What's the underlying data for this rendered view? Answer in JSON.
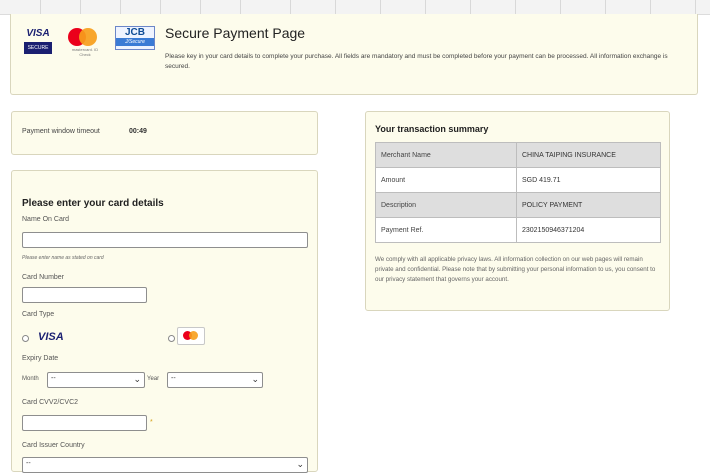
{
  "header": {
    "title": "Secure Payment Page",
    "description": "Please key in your card details to complete your purchase. All fields are mandatory and must be completed before your payment can be processed. All information exchange is secured.",
    "logos": {
      "visa_word": "VISA",
      "visa_sub": "SECURE",
      "mc_sub": "mastercard. ID Check",
      "jcb_word": "JCB",
      "jcb_sub": "J/Secure"
    }
  },
  "timeout": {
    "label": "Payment window timeout",
    "value": "00:49"
  },
  "card_form": {
    "title": "Please enter your card details",
    "name_on_card": {
      "label": "Name On Card",
      "value": "",
      "hint": "Please enter name as stated on card"
    },
    "card_number": {
      "label": "Card Number",
      "value": ""
    },
    "card_type": {
      "label": "Card Type",
      "options": [
        "visa-logo",
        "mastercard-logo"
      ],
      "visa_text": "VISA"
    },
    "expiry": {
      "label": "Expiry Date",
      "month_label": "Month",
      "month_value": "--",
      "year_label": "Year",
      "year_value": "--"
    },
    "cvv": {
      "label": "Card CVV2/CVC2",
      "value": "",
      "required_mark": "*"
    },
    "issuer_country": {
      "label": "Card Issuer Country",
      "value": "--"
    }
  },
  "summary": {
    "title": "Your transaction summary",
    "rows": [
      {
        "key": "Merchant Name",
        "value": "CHINA TAIPING INSURANCE"
      },
      {
        "key": "Amount",
        "value": "SGD 419.71"
      },
      {
        "key": "Description",
        "value": "POLICY PAYMENT"
      },
      {
        "key": "Payment Ref.",
        "value": "2302150946371204"
      }
    ],
    "note": "We comply with all applicable privacy laws. All information collection on our web pages will remain private and confidential. Please note that by submitting your personal information to us, you consent to our privacy statement that governs your account."
  },
  "colors": {
    "panel_bg": "#fdfcec",
    "panel_border": "#d9d6bd",
    "visa_blue": "#1a1f71",
    "mc_red": "#eb001b",
    "mc_orange": "#f79e1b"
  }
}
